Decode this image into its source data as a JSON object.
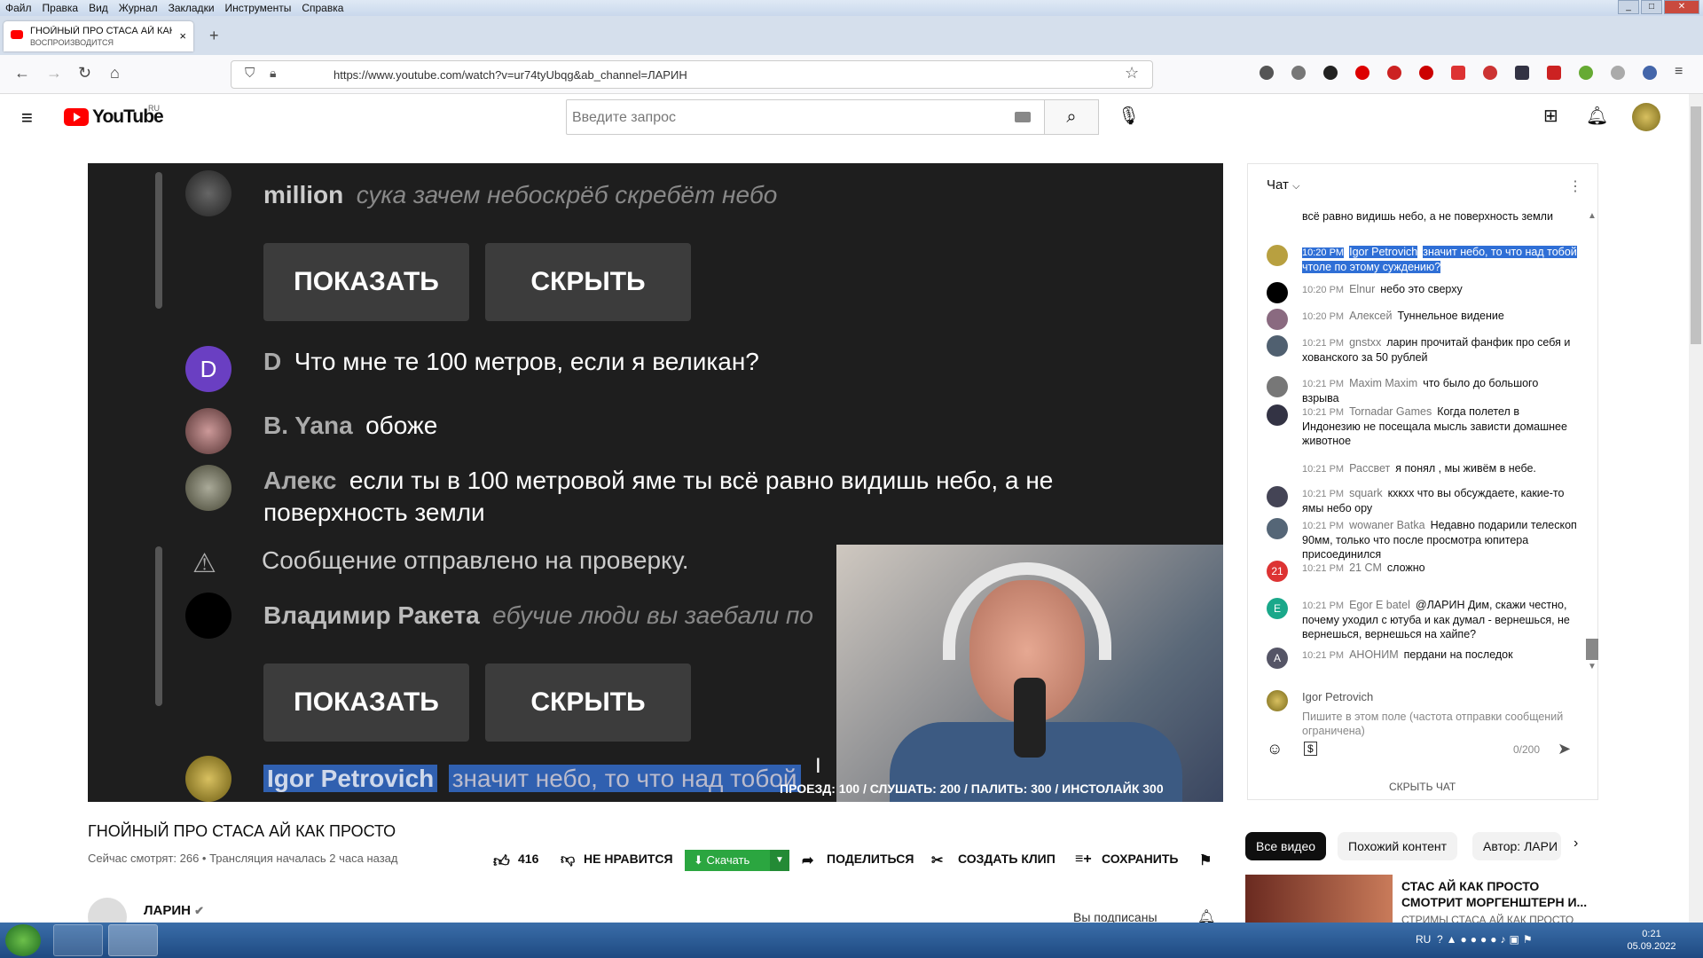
{
  "menubar": [
    "Файл",
    "Правка",
    "Вид",
    "Журнал",
    "Закладки",
    "Инструменты",
    "Справка"
  ],
  "tab": {
    "title": "ГНОЙНЫЙ ПРО СТАСА АЙ КАК ...",
    "subtitle": "ВОСПРОИЗВОДИТСЯ"
  },
  "url": "https://www.youtube.com/watch?v=ur74tyUbqg&ab_channel=ЛАРИН",
  "yt": {
    "logo": "YouTube",
    "logo_sup": "RU",
    "search_placeholder": "Введите запрос"
  },
  "video": {
    "overlay": [
      {
        "name": "million",
        "msg": "сука зачем небоскрёб скребёт небо",
        "italic": true
      },
      {
        "buttons": [
          "ПОКАЗАТЬ",
          "СКРЫТЬ"
        ]
      },
      {
        "name": "D",
        "msg": "Что мне те 100 метров, если я великан?"
      },
      {
        "name": "B. Yana",
        "msg": "обоже"
      },
      {
        "name": "Алекс",
        "msg": "если ты в 100 метровой яме ты всё равно видишь небо, а не",
        "msg2": "поверхность земли"
      },
      {
        "msg": "Сообщение отправлено на проверку."
      },
      {
        "name": "Владимир Ракета",
        "msg": "ебучие люди вы заебали по",
        "italic": true
      },
      {
        "buttons": [
          "ПОКАЗАТЬ",
          "СКРЫТЬ"
        ]
      },
      {
        "name": "Igor Petrovich",
        "msg": "значит небо, то что над тобой"
      }
    ],
    "d_avatar": "D",
    "ticker": "ПРОЕЗД: 100 / СЛУШАТЬ: 200 / ПАЛИТЬ: 300 / ИНСТОЛАЙК 300"
  },
  "below": {
    "title": "ГНОЙНЫЙ ПРО СТАСА АЙ КАК ПРОСТО",
    "meta": "Сейчас смотрят: 266 • Трансляция началась 2 часа назад",
    "likes": "416",
    "dislike": "НЕ НРАВИТСЯ",
    "download": "Скачать",
    "share": "ПОДЕЛИТЬСЯ",
    "clip": "СОЗДАТЬ КЛИП",
    "save": "СОХРАНИТЬ",
    "channel": "ЛАРИН",
    "subscribed": "Вы подписаны"
  },
  "chat": {
    "title": "Чат",
    "messages": [
      {
        "time": "",
        "author": "",
        "text": "всё равно видишь небо, а не поверхность земли",
        "av": "#999"
      },
      {
        "time": "10:20 PM",
        "author": "Igor Petrovich",
        "text": "значит небо, то что над тобой чтоле по этому суждению?",
        "av": "#b8a040",
        "hl": true
      },
      {
        "time": "10:20 PM",
        "author": "Elnur",
        "text": "небо это сверху",
        "av": "#000"
      },
      {
        "time": "10:20 PM",
        "author": "Алексей",
        "text": "Туннельное видение",
        "av": "#8a6a80"
      },
      {
        "time": "10:21 PM",
        "author": "gnstxx",
        "text": "ларин прочитай фанфик про себя и хованского за 50 рублей",
        "av": "#506070"
      },
      {
        "time": "10:21 PM",
        "author": "Maxim Maxim",
        "text": "что было до большого взрыва",
        "av": "#777"
      },
      {
        "time": "10:21 PM",
        "author": "Tornadar Games",
        "text": "Когда полетел в Индонезию не посещала мысль зависти домашнее животное",
        "av": "#334"
      },
      {
        "time": "10:21 PM",
        "author": "Рассвет",
        "text": "я понял , мы живём в небе.",
        "av": "#fff"
      },
      {
        "time": "10:21 PM",
        "author": "squark",
        "text": "кхкхх что вы обсуждаете, какие-то ямы небо ору",
        "av": "#445"
      },
      {
        "time": "10:21 PM",
        "author": "wowaner Batka",
        "text": "Недавно подарили телескоп 90мм, только что после просмотра юпитера присоединился",
        "av": "#567"
      },
      {
        "time": "10:21 PM",
        "author": "21 CM",
        "text": "сложно",
        "av": "#d33",
        "letter": "21"
      },
      {
        "time": "10:21 PM",
        "author": "Egor E batel",
        "text": "@ЛАРИН Дим, скажи честно, почему уходил с ютуба и как думал - вернешься, не вернешься, вернешься на хайпе?",
        "av": "#1aa88a",
        "letter": "E"
      },
      {
        "time": "10:21 PM",
        "author": "АНОНИМ",
        "text": "пердани на последок",
        "av": "#556",
        "letter": "A"
      }
    ],
    "input_name": "Igor Petrovich",
    "input_placeholder": "Пишите в этом поле (частота отправки сообщений ограничена)",
    "count": "0/200",
    "hide": "СКРЫТЬ ЧАТ"
  },
  "chips": [
    "Все видео",
    "Похожий контент",
    "Автор: ЛАРИ"
  ],
  "recommendation": {
    "title": "СТАС АЙ КАК ПРОСТО СМОТРИТ МОРГЕНШТЕРН И...",
    "sub": "СТРИМЫ СТАСА АЙ КАК ПРОСТО"
  },
  "tray": {
    "lang": "RU",
    "time": "0:21",
    "date": "05.09.2022"
  }
}
